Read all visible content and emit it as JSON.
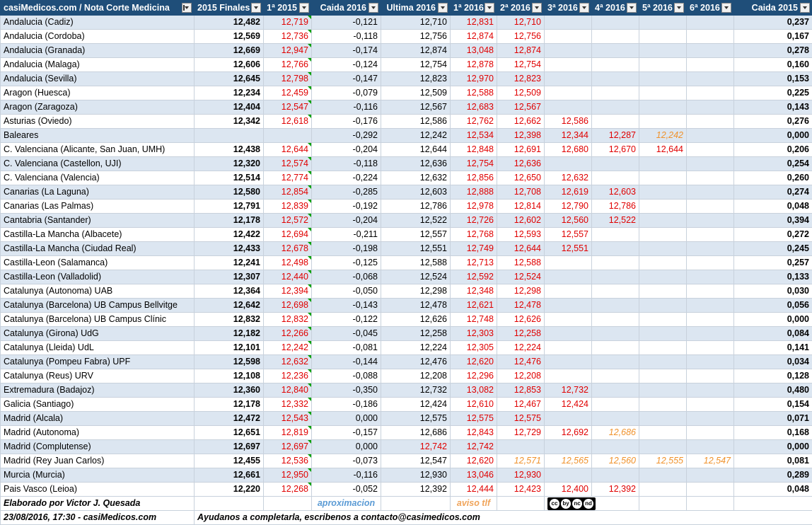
{
  "headers": [
    "casiMedicos.com / Nota Corte Medicina",
    "2015 Finales",
    "1ª 2015",
    "Caida 2016",
    "Ultima 2016",
    "1ª 2016",
    "2ª 2016",
    "3ª 2016",
    "4ª 2016",
    "5ª 2016",
    "6ª 2016",
    "Caida 2015"
  ],
  "rows": [
    {
      "name": "Andalucia (Cadiz)",
      "f2015": "12,482",
      "p2015": "12,719",
      "caida16": "-0,121",
      "ult16": "12,710",
      "r1": "12,831",
      "r2": "12,710",
      "r3": "",
      "r4": "",
      "r5": "",
      "r6": "",
      "caida15": "0,237"
    },
    {
      "name": "Andalucia (Cordoba)",
      "f2015": "12,569",
      "p2015": "12,736",
      "caida16": "-0,118",
      "ult16": "12,756",
      "r1": "12,874",
      "r2": "12,756",
      "r3": "",
      "r4": "",
      "r5": "",
      "r6": "",
      "caida15": "0,167"
    },
    {
      "name": "Andalucia (Granada)",
      "f2015": "12,669",
      "p2015": "12,947",
      "caida16": "-0,174",
      "ult16": "12,874",
      "r1": "13,048",
      "r2": "12,874",
      "r3": "",
      "r4": "",
      "r5": "",
      "r6": "",
      "caida15": "0,278"
    },
    {
      "name": "Andalucia (Malaga)",
      "f2015": "12,606",
      "p2015": "12,766",
      "caida16": "-0,124",
      "ult16": "12,754",
      "r1": "12,878",
      "r2": "12,754",
      "r3": "",
      "r4": "",
      "r5": "",
      "r6": "",
      "caida15": "0,160"
    },
    {
      "name": "Andalucia (Sevilla)",
      "f2015": "12,645",
      "p2015": "12,798",
      "caida16": "-0,147",
      "ult16": "12,823",
      "r1": "12,970",
      "r2": "12,823",
      "r3": "",
      "r4": "",
      "r5": "",
      "r6": "",
      "caida15": "0,153"
    },
    {
      "name": "Aragon (Huesca)",
      "f2015": "12,234",
      "p2015": "12,459",
      "caida16": "-0,079",
      "ult16": "12,509",
      "r1": "12,588",
      "r2": "12,509",
      "r3": "",
      "r4": "",
      "r5": "",
      "r6": "",
      "caida15": "0,225"
    },
    {
      "name": "Aragon (Zaragoza)",
      "f2015": "12,404",
      "p2015": "12,547",
      "caida16": "-0,116",
      "ult16": "12,567",
      "r1": "12,683",
      "r2": "12,567",
      "r3": "",
      "r4": "",
      "r5": "",
      "r6": "",
      "caida15": "0,143"
    },
    {
      "name": "Asturias (Oviedo)",
      "f2015": "12,342",
      "p2015": "12,618",
      "caida16": "-0,176",
      "ult16": "12,586",
      "r1": "12,762",
      "r2": "12,662",
      "r3": "12,586",
      "r4": "",
      "r5": "",
      "r6": "",
      "caida15": "0,276"
    },
    {
      "name": "Baleares",
      "f2015": "",
      "p2015": "",
      "caida16": "-0,292",
      "ult16": "12,242",
      "r1": "12,534",
      "r2": "12,398",
      "r3": "12,344",
      "r4": "12,287",
      "r5": "12,242",
      "r6": "",
      "caida15": "0,000",
      "orange5": true
    },
    {
      "name": "C. Valenciana (Alicante, San Juan, UMH)",
      "f2015": "12,438",
      "p2015": "12,644",
      "caida16": "-0,204",
      "ult16": "12,644",
      "r1": "12,848",
      "r2": "12,691",
      "r3": "12,680",
      "r4": "12,670",
      "r5": "12,644",
      "r6": "",
      "caida15": "0,206"
    },
    {
      "name": "C. Valenciana (Castellon, UJI)",
      "f2015": "12,320",
      "p2015": "12,574",
      "caida16": "-0,118",
      "ult16": "12,636",
      "r1": "12,754",
      "r2": "12,636",
      "r3": "",
      "r4": "",
      "r5": "",
      "r6": "",
      "caida15": "0,254"
    },
    {
      "name": "C. Valenciana (Valencia)",
      "f2015": "12,514",
      "p2015": "12,774",
      "caida16": "-0,224",
      "ult16": "12,632",
      "r1": "12,856",
      "r2": "12,650",
      "r3": "12,632",
      "r4": "",
      "r5": "",
      "r6": "",
      "caida15": "0,260"
    },
    {
      "name": "Canarias (La Laguna)",
      "f2015": "12,580",
      "p2015": "12,854",
      "caida16": "-0,285",
      "ult16": "12,603",
      "r1": "12,888",
      "r2": "12,708",
      "r3": "12,619",
      "r4": "12,603",
      "r5": "",
      "r6": "",
      "caida15": "0,274"
    },
    {
      "name": "Canarias (Las Palmas)",
      "f2015": "12,791",
      "p2015": "12,839",
      "caida16": "-0,192",
      "ult16": "12,786",
      "r1": "12,978",
      "r2": "12,814",
      "r3": "12,790",
      "r4": "12,786",
      "r5": "",
      "r6": "",
      "caida15": "0,048"
    },
    {
      "name": "Cantabria (Santander)",
      "f2015": "12,178",
      "p2015": "12,572",
      "caida16": "-0,204",
      "ult16": "12,522",
      "r1": "12,726",
      "r2": "12,602",
      "r3": "12,560",
      "r4": "12,522",
      "r5": "",
      "r6": "",
      "caida15": "0,394"
    },
    {
      "name": "Castilla-La Mancha (Albacete)",
      "f2015": "12,422",
      "p2015": "12,694",
      "caida16": "-0,211",
      "ult16": "12,557",
      "r1": "12,768",
      "r2": "12,593",
      "r3": "12,557",
      "r4": "",
      "r5": "",
      "r6": "",
      "caida15": "0,272"
    },
    {
      "name": "Castilla-La Mancha (Ciudad Real)",
      "f2015": "12,433",
      "p2015": "12,678",
      "caida16": "-0,198",
      "ult16": "12,551",
      "r1": "12,749",
      "r2": "12,644",
      "r3": "12,551",
      "r4": "",
      "r5": "",
      "r6": "",
      "caida15": "0,245"
    },
    {
      "name": "Castilla-Leon (Salamanca)",
      "f2015": "12,241",
      "p2015": "12,498",
      "caida16": "-0,125",
      "ult16": "12,588",
      "r1": "12,713",
      "r2": "12,588",
      "r3": "",
      "r4": "",
      "r5": "",
      "r6": "",
      "caida15": "0,257"
    },
    {
      "name": "Castilla-Leon (Valladolid)",
      "f2015": "12,307",
      "p2015": "12,440",
      "caida16": "-0,068",
      "ult16": "12,524",
      "r1": "12,592",
      "r2": "12,524",
      "r3": "",
      "r4": "",
      "r5": "",
      "r6": "",
      "caida15": "0,133"
    },
    {
      "name": "Catalunya (Autonoma) UAB",
      "f2015": "12,364",
      "p2015": "12,394",
      "caida16": "-0,050",
      "ult16": "12,298",
      "r1": "12,348",
      "r2": "12,298",
      "r3": "",
      "r4": "",
      "r5": "",
      "r6": "",
      "caida15": "0,030"
    },
    {
      "name": "Catalunya (Barcelona) UB Campus Bellvitge",
      "f2015": "12,642",
      "p2015": "12,698",
      "caida16": "-0,143",
      "ult16": "12,478",
      "r1": "12,621",
      "r2": "12,478",
      "r3": "",
      "r4": "",
      "r5": "",
      "r6": "",
      "caida15": "0,056"
    },
    {
      "name": "Catalunya (Barcelona) UB Campus Clínic",
      "f2015": "12,832",
      "p2015": "12,832",
      "caida16": "-0,122",
      "ult16": "12,626",
      "r1": "12,748",
      "r2": "12,626",
      "r3": "",
      "r4": "",
      "r5": "",
      "r6": "",
      "caida15": "0,000"
    },
    {
      "name": "Catalunya (Girona) UdG",
      "f2015": "12,182",
      "p2015": "12,266",
      "caida16": "-0,045",
      "ult16": "12,258",
      "r1": "12,303",
      "r2": "12,258",
      "r3": "",
      "r4": "",
      "r5": "",
      "r6": "",
      "caida15": "0,084"
    },
    {
      "name": "Catalunya (Lleida) UdL",
      "f2015": "12,101",
      "p2015": "12,242",
      "caida16": "-0,081",
      "ult16": "12,224",
      "r1": "12,305",
      "r2": "12,224",
      "r3": "",
      "r4": "",
      "r5": "",
      "r6": "",
      "caida15": "0,141"
    },
    {
      "name": "Catalunya (Pompeu Fabra) UPF",
      "f2015": "12,598",
      "p2015": "12,632",
      "caida16": "-0,144",
      "ult16": "12,476",
      "r1": "12,620",
      "r2": "12,476",
      "r3": "",
      "r4": "",
      "r5": "",
      "r6": "",
      "caida15": "0,034"
    },
    {
      "name": "Catalunya (Reus) URV",
      "f2015": "12,108",
      "p2015": "12,236",
      "caida16": "-0,088",
      "ult16": "12,208",
      "r1": "12,296",
      "r2": "12,208",
      "r3": "",
      "r4": "",
      "r5": "",
      "r6": "",
      "caida15": "0,128"
    },
    {
      "name": "Extremadura (Badajoz)",
      "f2015": "12,360",
      "p2015": "12,840",
      "caida16": "-0,350",
      "ult16": "12,732",
      "r1": "13,082",
      "r2": "12,853",
      "r3": "12,732",
      "r4": "",
      "r5": "",
      "r6": "",
      "caida15": "0,480"
    },
    {
      "name": "Galicia (Santiago)",
      "f2015": "12,178",
      "p2015": "12,332",
      "caida16": "-0,186",
      "ult16": "12,424",
      "r1": "12,610",
      "r2": "12,467",
      "r3": "12,424",
      "r4": "",
      "r5": "",
      "r6": "",
      "caida15": "0,154"
    },
    {
      "name": "Madrid (Alcala)",
      "f2015": "12,472",
      "p2015": "12,543",
      "caida16": "0,000",
      "ult16": "12,575",
      "r1": "12,575",
      "r2": "12,575",
      "r3": "",
      "r4": "",
      "r5": "",
      "r6": "",
      "caida15": "0,071"
    },
    {
      "name": "Madrid (Autonoma)",
      "f2015": "12,651",
      "p2015": "12,819",
      "caida16": "-0,157",
      "ult16": "12,686",
      "r1": "12,843",
      "r2": "12,729",
      "r3": "12,692",
      "r4": "12,686",
      "r5": "",
      "r6": "",
      "caida15": "0,168",
      "orange4": true
    },
    {
      "name": "Madrid (Complutense)",
      "f2015": "12,697",
      "p2015": "12,697",
      "caida16": "0,000",
      "ult16": "12,742",
      "r1": "12,742",
      "r2": "",
      "r3": "",
      "r4": "",
      "r5": "",
      "r6": "",
      "caida15": "0,000",
      "redUlt": true
    },
    {
      "name": "Madrid (Rey Juan Carlos)",
      "f2015": "12,455",
      "p2015": "12,536",
      "caida16": "-0,073",
      "ult16": "12,547",
      "r1": "12,620",
      "r2": "12,571",
      "r3": "12,565",
      "r4": "12,560",
      "r5": "12,555",
      "r6": "12,547",
      "caida15": "0,081",
      "orangeFrom2": true
    },
    {
      "name": "Murcia (Murcia)",
      "f2015": "12,661",
      "p2015": "12,950",
      "caida16": "-0,116",
      "ult16": "12,930",
      "r1": "13,046",
      "r2": "12,930",
      "r3": "",
      "r4": "",
      "r5": "",
      "r6": "",
      "caida15": "0,289"
    },
    {
      "name": "Pais Vasco (Leioa)",
      "f2015": "12,220",
      "p2015": "12,268",
      "caida16": "-0,052",
      "ult16": "12,392",
      "r1": "12,444",
      "r2": "12,423",
      "r3": "12,400",
      "r4": "12,392",
      "r5": "",
      "r6": "",
      "caida15": "0,048"
    }
  ],
  "footer": {
    "author": "Elaborado por Victor J. Quesada",
    "legend_approx": "aproximacion",
    "legend_phone": "aviso tlf",
    "date": "23/08/2016, 17:30 - casiMedicos.com",
    "help": "Ayudanos a completarla, escribenos a contacto@casimedicos.com",
    "license": [
      "cc",
      "by",
      "nc",
      "nd"
    ]
  },
  "colors": {
    "header": "#1f4e79",
    "band": "#dce6f1",
    "red": "#e00000",
    "orange": "#f0922b",
    "blue": "#5b9bd5"
  }
}
